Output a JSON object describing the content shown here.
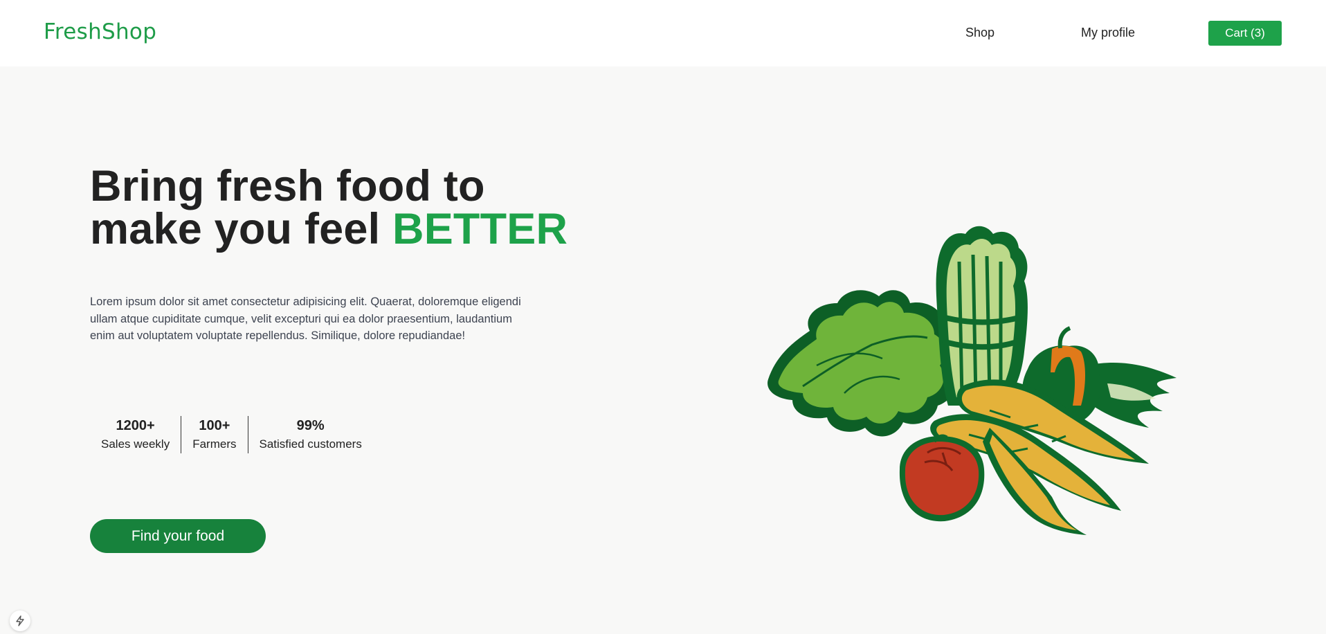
{
  "header": {
    "logo": "FreshShop",
    "nav": {
      "shop": "Shop",
      "profile": "My profile"
    },
    "cart_label": "Cart (3)"
  },
  "hero": {
    "title_line1": "Bring fresh food to",
    "title_line2_prefix": "make you feel ",
    "title_accent": "BETTER",
    "description": "Lorem ipsum dolor sit amet consectetur adipisicing elit. Quaerat, doloremque eligendi ullam atque cupiditate cumque, velit excepturi qui ea dolor praesentium, laudantium enim aut voluptatem voluptate repellendus. Similique, dolore repudiandae!",
    "stats": [
      {
        "value": "1200+",
        "label": "Sales weekly"
      },
      {
        "value": "100+",
        "label": "Farmers"
      },
      {
        "value": "99%",
        "label": "Satisfied customers"
      }
    ],
    "cta_label": "Find your food",
    "illustration_icon": "vegetables-illustration"
  },
  "corner_badge_icon": "lightning-icon",
  "colors": {
    "brand": "#1ea24a",
    "cta": "#17823c",
    "background": "#f8f8f7",
    "header": "#ffffff"
  }
}
